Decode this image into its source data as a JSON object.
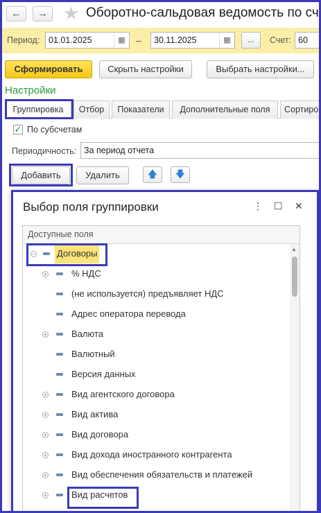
{
  "window": {
    "title": "Оборотно-сальдовая ведомость по сч",
    "back_icon": "←",
    "forward_icon": "→",
    "star_icon": "★"
  },
  "period": {
    "label": "Период:",
    "from": "01.01.2025",
    "dash": "–",
    "to": "30.11.2025",
    "dots": "...",
    "account_label": "Счет:",
    "account_value": "60",
    "calendar_icon": "calendar-icon"
  },
  "toolbar": {
    "generate": "Сформировать",
    "hide_settings": "Скрыть настройки",
    "choose_settings": "Выбрать настройки..."
  },
  "settings": {
    "title": "Настройки",
    "tabs": [
      "Группировка",
      "Отбор",
      "Показатели",
      "Дополнительные поля",
      "Сортиро"
    ],
    "by_subaccounts": "По субсчетам",
    "periodicity_label": "Периодичность:",
    "periodicity_value": "За период отчета",
    "add": "Добавить",
    "delete": "Удалить"
  },
  "dialog": {
    "title": "Выбор поля группировки",
    "more_icon": "⋮",
    "maximize_icon": "☐",
    "close_icon": "✕",
    "column_header": "Доступные поля",
    "items": [
      "Договоры",
      "% НДС",
      "(не используется) предъявляет НДС",
      "Адрес оператора перевода",
      "Валюта",
      "Валютный",
      "Версия данных",
      "Вид агентского договора",
      "Вид актива",
      "Вид договора",
      "Вид дохода иностранного контрагента",
      "Вид обеспечения обязательств и платежей",
      "Вид расчетов"
    ]
  }
}
